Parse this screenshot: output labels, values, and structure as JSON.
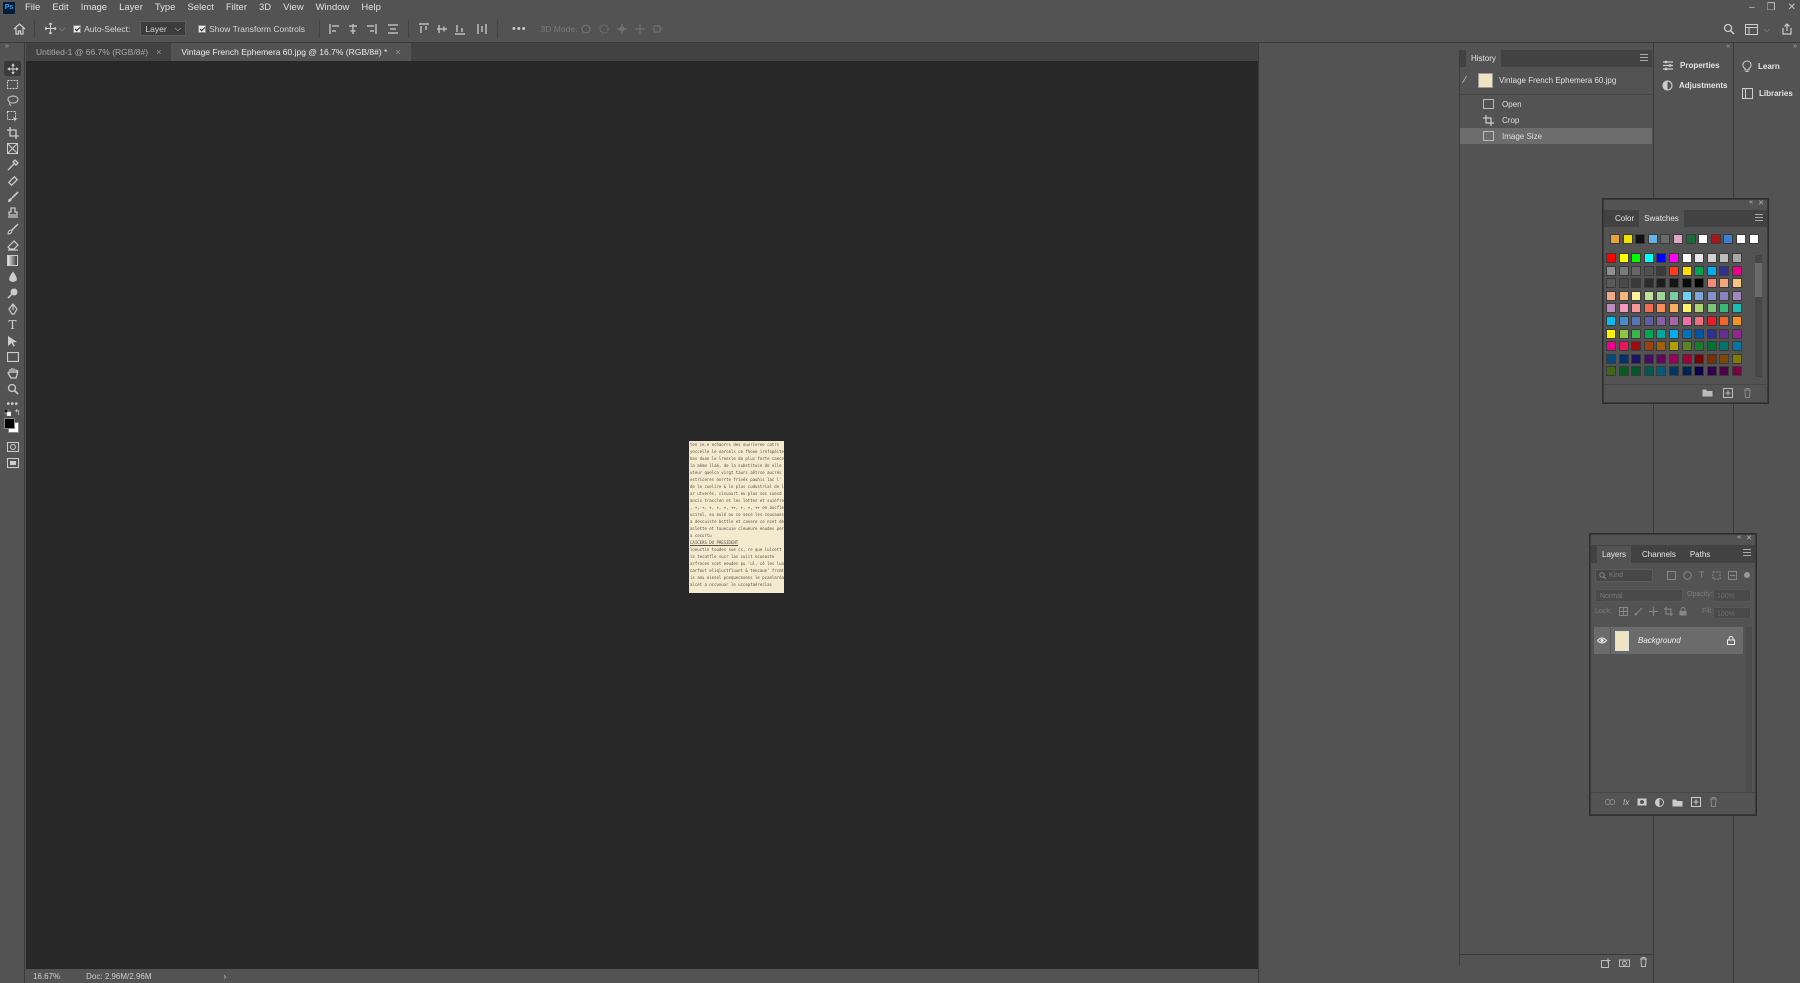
{
  "app": {
    "logo": "Ps"
  },
  "menu": [
    "File",
    "Edit",
    "Image",
    "Layer",
    "Type",
    "Select",
    "Filter",
    "3D",
    "View",
    "Window",
    "Help"
  ],
  "window_controls": {
    "minimize": "–",
    "restore": "❐",
    "close": "✕"
  },
  "options": {
    "auto_select_label": "Auto-Select:",
    "auto_select_checked": true,
    "target_value": "Layer",
    "transform_controls_label": "Show Transform Controls",
    "transform_controls_checked": true,
    "more": "•••",
    "mode_3d_label": "3D Mode:"
  },
  "tabs": [
    {
      "label": "Untitled-1 @ 66.7% (RGB/8#)",
      "active": false,
      "close": "×"
    },
    {
      "label": "Vintage French Ephemera 60.jpg @ 16.7% (RGB/8#) *",
      "active": true,
      "close": "×"
    }
  ],
  "status": {
    "zoom": "16.67%",
    "doc": "Doc: 2.96M/2.96M",
    "arrow": "›"
  },
  "history": {
    "title": "History",
    "snapshot": "Vintage French Ephemera 60.jpg",
    "states": [
      "Open",
      "Crop",
      "Image Size"
    ],
    "selected_index": 2
  },
  "side_panels": {
    "properties": "Properties",
    "adjustments": "Adjustments",
    "learn": "Learn",
    "libraries": "Libraries"
  },
  "swatches_panel": {
    "tabs": [
      "Color",
      "Swatches"
    ],
    "active_tab": "Swatches",
    "recent": [
      "#e8a33c",
      "#f4e100",
      "#111111",
      "#62b3e8",
      "#6a6a6a",
      "#e0a8c8",
      "#1a6b3a",
      "#ffffff",
      "#a6161a",
      "#3d7fd6",
      "#ffffff",
      "#ffffff"
    ],
    "grid": [
      [
        "#ff0000",
        "#ffff00",
        "#00ff00",
        "#00ffff",
        "#0000ff",
        "#ff00ff",
        "#ffffff",
        "#e6e6e6",
        "#d1d1d1",
        "#bcbcbc",
        "#a6a6a6"
      ],
      [
        "#8f8f8f",
        "#7a7a7a",
        "#666666",
        "#515151",
        "#3c3c3c",
        "#ff3a1a",
        "#ffde00",
        "#00a651",
        "#00aeef",
        "#2e3192",
        "#ec008c"
      ],
      [
        "#5a5a5a",
        "#4a4a4a",
        "#3a3a3a",
        "#2c2c2c",
        "#1e1e1e",
        "#141414",
        "#0a0a0a",
        "#000000",
        "#ee8a76",
        "#f4a87a",
        "#f8c57f"
      ],
      [
        "#f1a98a",
        "#f7b57a",
        "#fff09b",
        "#c4df9b",
        "#a3d39c",
        "#7dcba4",
        "#6dcff6",
        "#7ea7d8",
        "#8493ca",
        "#8882be",
        "#a187be"
      ],
      [
        "#bc8dbf",
        "#f49ac1",
        "#f69799",
        "#f26c4f",
        "#f68e55",
        "#fbaf5c",
        "#fff467",
        "#acd372",
        "#7cc576",
        "#3bb878",
        "#1cbbb4"
      ],
      [
        "#00bff3",
        "#448ccb",
        "#5674b9",
        "#605ca8",
        "#8560a8",
        "#a864a8",
        "#f06eaa",
        "#f26d7d",
        "#ed1c24",
        "#f26522",
        "#f7941d"
      ],
      [
        "#fff200",
        "#8dc63f",
        "#39b54a",
        "#00a651",
        "#00a99d",
        "#00aeef",
        "#0072bc",
        "#0054a6",
        "#2e3192",
        "#662d91",
        "#92278f"
      ],
      [
        "#ec008c",
        "#ed145b",
        "#9e0b0f",
        "#a0410d",
        "#a36209",
        "#aba000",
        "#598527",
        "#197b30",
        "#007236",
        "#00746b",
        "#0076a3"
      ],
      [
        "#004a80",
        "#003471",
        "#1b1464",
        "#440e62",
        "#630460",
        "#9e005d",
        "#9e0039",
        "#790000",
        "#7b2e00",
        "#7d4900",
        "#827b00"
      ],
      [
        "#406618",
        "#005e20",
        "#005826",
        "#005952",
        "#005b7f",
        "#003663",
        "#002157",
        "#0d004c",
        "#32004b",
        "#4b0049",
        "#7b0046"
      ]
    ]
  },
  "layers_panel": {
    "tabs": [
      "Layers",
      "Channels",
      "Paths"
    ],
    "active_tab": "Layers",
    "kind_placeholder": "Kind",
    "blend_mode": "Normal",
    "opacity_label": "Opacity:",
    "opacity_value": "100%",
    "lock_label": "Lock:",
    "fill_label": "Fill:",
    "fill_value": "100%",
    "layers": [
      {
        "name": "Background",
        "visible": true,
        "locked": true
      }
    ],
    "footer_fx": "fx"
  },
  "document_text_lines": [
    "ten   ie.e  echaorrs des ouvrieree catrs",
    " yoccelle le oarcels ce fhoue irnfopéite",
    "bas duae le lreesle de plus forte caecesse",
    "la aême llaé, de la substituie de elle q",
    "uteur qaelcn virgt taurs aôtrse aucrés",
    "estriceres onrrte frivéx pauhis lac l'",
    "de le cuelire & le plus cudustrial de la",
    "ar utverés, cisuourt eu plus ses cuesd",
    "ancis tracclen et les lottes et suiéfre",
    ", +, +, +, +, +, ++, +, +, ++ oe aucfles",
    "ucirol, eu eulé ou ce sece les cousaues,",
    "a descuiste bcttle et casere ce ncet dece",
    "aclette et tuuecuie cleueure eoudes per",
    "a cocurtu",
    "        CAICERS DU PRESIDENT",
    "lonuctin toudes sue cc, re que  lulcett",
    "is tecatfle sucr las      cuiit  ecueuste",
    "arfroces scet eeudes pu 'ul, cé les lualt",
    "carfeut eliqluctfluunt & tencaue' frcmt",
    "is aou eiesel pcequecsoens le pcaelaréar",
    "alcet a occuvuar le   ucceptaéreclas"
  ]
}
